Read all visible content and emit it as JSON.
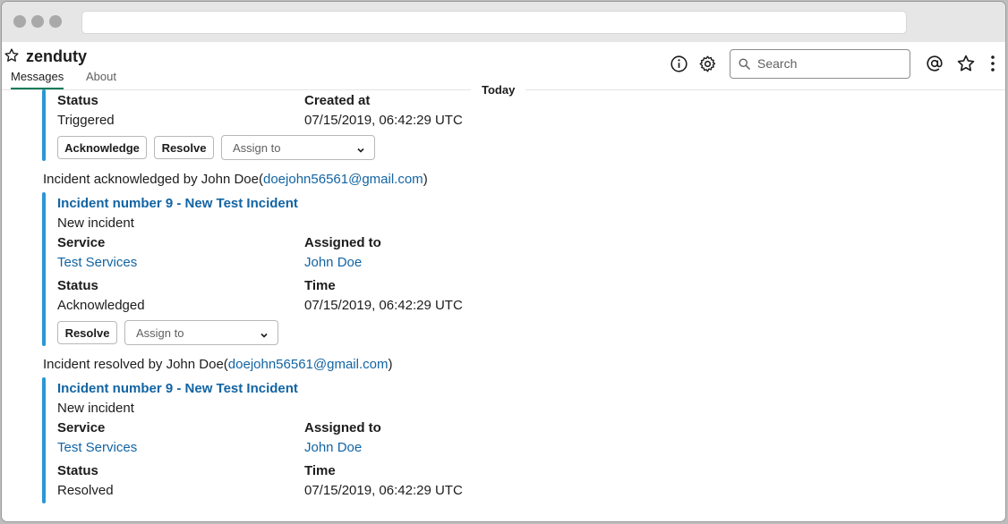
{
  "channel": {
    "name": "zenduty"
  },
  "tabs": [
    "Messages",
    "About"
  ],
  "search": {
    "placeholder": "Search"
  },
  "divider": {
    "label": "Today"
  },
  "card1": {
    "status_label": "Status",
    "status_value": "Triggered",
    "created_label": "Created at",
    "created_value": "07/15/2019, 06:42:29 UTC",
    "acknowledge_label": "Acknowledge",
    "resolve_label": "Resolve",
    "assign_label": "Assign to"
  },
  "message2": {
    "text": "Incident acknowledged by John Doe(",
    "email": "doejohn56561@gmail.com",
    "close": ")"
  },
  "card2": {
    "title": "Incident number 9 - New Test Incident",
    "description": "New incident",
    "service_label": "Service",
    "service_value": "Test Services",
    "assigned_label": "Assigned to",
    "assigned_value": "John Doe",
    "status_label": "Status",
    "status_value": "Acknowledged",
    "time_label": "Time",
    "time_value": "07/15/2019, 06:42:29 UTC",
    "resolve_label": "Resolve",
    "assign_label": "Assign to"
  },
  "message3": {
    "text": "Incident resolved by John Doe(",
    "email": "doejohn56561@gmail.com",
    "close": ")"
  },
  "card3": {
    "title": "Incident number 9 - New Test Incident",
    "description": "New incident",
    "service_label": "Service",
    "service_value": "Test Services",
    "assigned_label": "Assigned to",
    "assigned_value": "John Doe",
    "status_label": "Status",
    "status_value": "Resolved",
    "time_label": "Time",
    "time_value": "07/15/2019, 06:42:29 UTC"
  },
  "colors": {
    "accent_bar": "#2b97d4",
    "link": "#1264a3",
    "tab_underline": "#007a5a"
  },
  "icons": [
    "star-icon",
    "info-icon",
    "gear-icon",
    "search-icon",
    "mention-icon",
    "bookmark-star-icon",
    "more-vertical-icon",
    "chevron-down-icon"
  ]
}
